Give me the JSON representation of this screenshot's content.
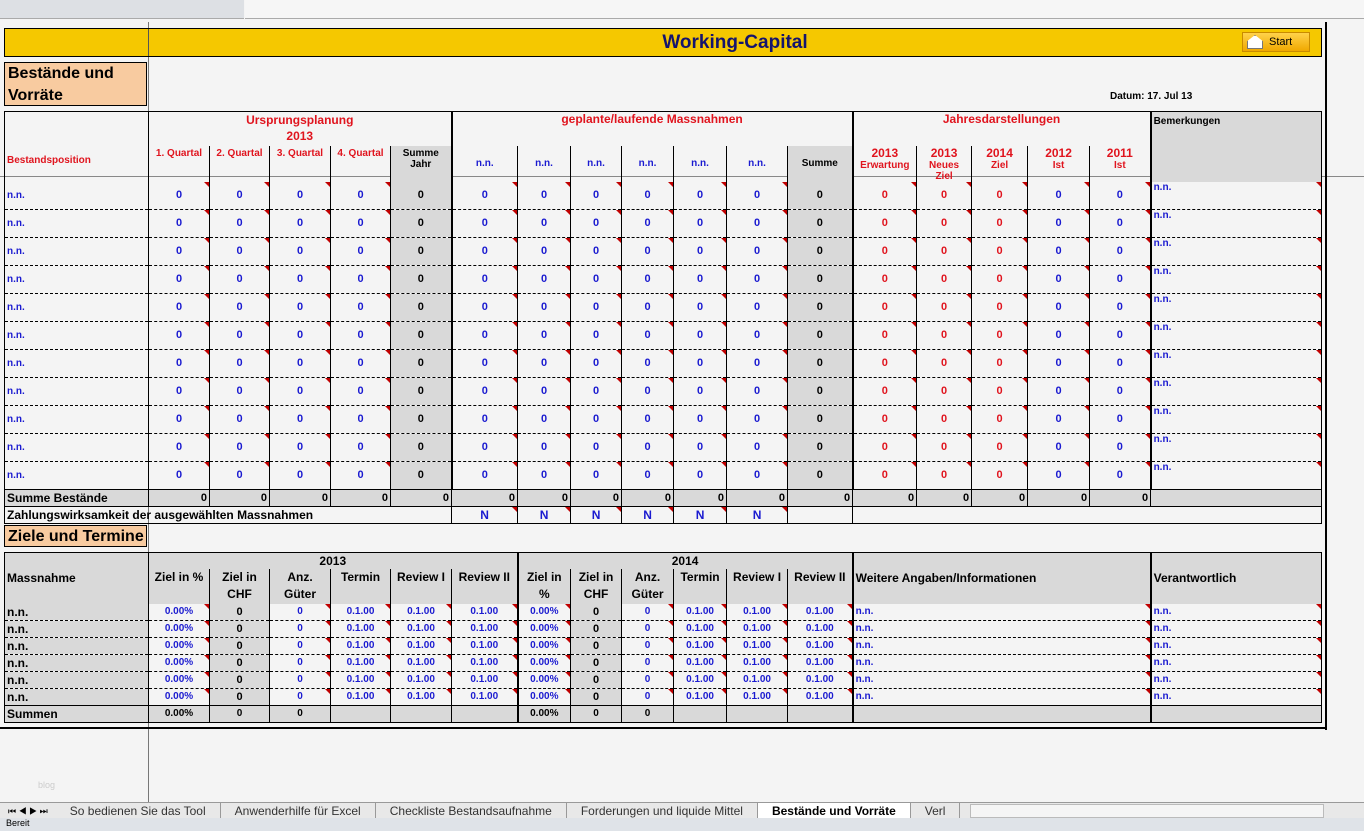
{
  "title": "Working-Capital",
  "start_label": "Start",
  "section1": "Bestände und Vorräte",
  "datum_label": "Datum:",
  "datum_value": "17. Jul 13",
  "top": {
    "pos_header": "Bestandsposition",
    "group1": "Ursprungsplanung",
    "group1_year": "2013",
    "quarters": [
      "1. Quartal",
      "2. Quartal",
      "3. Quartal",
      "4. Quartal"
    ],
    "sum_year": "Summe Jahr",
    "group2": "geplante/laufende Massnahmen",
    "measures": [
      "n.n.",
      "n.n.",
      "n.n.",
      "n.n.",
      "n.n.",
      "n.n."
    ],
    "sum": "Summe",
    "group3": "Jahresdarstellungen",
    "years": [
      {
        "y": "2013",
        "l": "Erwartung"
      },
      {
        "y": "2013",
        "l": "Neues Ziel"
      },
      {
        "y": "2014",
        "l": "Ziel"
      },
      {
        "y": "2012",
        "l": "Ist"
      },
      {
        "y": "2011",
        "l": "Ist"
      }
    ],
    "remarks": "Bemerkungen",
    "rows": [
      [
        "n.n.",
        "0",
        "0",
        "0",
        "0",
        "0",
        "0",
        "0",
        "0",
        "0",
        "0",
        "0",
        "0",
        "0",
        "0",
        "0",
        "0",
        "0",
        "n.n."
      ],
      [
        "n.n.",
        "0",
        "0",
        "0",
        "0",
        "0",
        "0",
        "0",
        "0",
        "0",
        "0",
        "0",
        "0",
        "0",
        "0",
        "0",
        "0",
        "0",
        "n.n."
      ],
      [
        "n.n.",
        "0",
        "0",
        "0",
        "0",
        "0",
        "0",
        "0",
        "0",
        "0",
        "0",
        "0",
        "0",
        "0",
        "0",
        "0",
        "0",
        "0",
        "n.n."
      ],
      [
        "n.n.",
        "0",
        "0",
        "0",
        "0",
        "0",
        "0",
        "0",
        "0",
        "0",
        "0",
        "0",
        "0",
        "0",
        "0",
        "0",
        "0",
        "0",
        "n.n."
      ],
      [
        "n.n.",
        "0",
        "0",
        "0",
        "0",
        "0",
        "0",
        "0",
        "0",
        "0",
        "0",
        "0",
        "0",
        "0",
        "0",
        "0",
        "0",
        "0",
        "n.n."
      ],
      [
        "n.n.",
        "0",
        "0",
        "0",
        "0",
        "0",
        "0",
        "0",
        "0",
        "0",
        "0",
        "0",
        "0",
        "0",
        "0",
        "0",
        "0",
        "0",
        "n.n."
      ],
      [
        "n.n.",
        "0",
        "0",
        "0",
        "0",
        "0",
        "0",
        "0",
        "0",
        "0",
        "0",
        "0",
        "0",
        "0",
        "0",
        "0",
        "0",
        "0",
        "n.n."
      ],
      [
        "n.n.",
        "0",
        "0",
        "0",
        "0",
        "0",
        "0",
        "0",
        "0",
        "0",
        "0",
        "0",
        "0",
        "0",
        "0",
        "0",
        "0",
        "0",
        "n.n."
      ],
      [
        "n.n.",
        "0",
        "0",
        "0",
        "0",
        "0",
        "0",
        "0",
        "0",
        "0",
        "0",
        "0",
        "0",
        "0",
        "0",
        "0",
        "0",
        "0",
        "n.n."
      ],
      [
        "n.n.",
        "0",
        "0",
        "0",
        "0",
        "0",
        "0",
        "0",
        "0",
        "0",
        "0",
        "0",
        "0",
        "0",
        "0",
        "0",
        "0",
        "0",
        "n.n."
      ],
      [
        "n.n.",
        "0",
        "0",
        "0",
        "0",
        "0",
        "0",
        "0",
        "0",
        "0",
        "0",
        "0",
        "0",
        "0",
        "0",
        "0",
        "0",
        "0",
        "n.n."
      ]
    ],
    "sum_row": [
      "Summe Bestände",
      "0",
      "0",
      "0",
      "0",
      "0",
      "0",
      "0",
      "0",
      "0",
      "0",
      "0",
      "0",
      "0",
      "0",
      "0",
      "0",
      "0",
      ""
    ],
    "pay_label": "Zahlungswirksamkeit der ausgewählten Massnahmen",
    "pay_values": [
      "N",
      "N",
      "N",
      "N",
      "N",
      "N"
    ]
  },
  "section2": "Ziele und Termine",
  "bottom": {
    "massnahme": "Massnahme",
    "year1": "2013",
    "year2": "2014",
    "cols": [
      "Ziel in %",
      "Ziel in CHF",
      "Anz. Güter",
      "Termin",
      "Review I",
      "Review II",
      "Ziel in %",
      "Ziel in CHF",
      "Anz. Güter",
      "Termin",
      "Review I",
      "Review II"
    ],
    "info": "Weitere Angaben/Informationen",
    "resp": "Verantwortlich",
    "rows": [
      [
        "n.n.",
        "0.00%",
        "0",
        "0",
        "0.1.00",
        "0.1.00",
        "0.1.00",
        "0.00%",
        "0",
        "0",
        "0.1.00",
        "0.1.00",
        "0.1.00",
        "n.n.",
        "n.n."
      ],
      [
        "n.n.",
        "0.00%",
        "0",
        "0",
        "0.1.00",
        "0.1.00",
        "0.1.00",
        "0.00%",
        "0",
        "0",
        "0.1.00",
        "0.1.00",
        "0.1.00",
        "n.n.",
        "n.n."
      ],
      [
        "n.n.",
        "0.00%",
        "0",
        "0",
        "0.1.00",
        "0.1.00",
        "0.1.00",
        "0.00%",
        "0",
        "0",
        "0.1.00",
        "0.1.00",
        "0.1.00",
        "n.n.",
        "n.n."
      ],
      [
        "n.n.",
        "0.00%",
        "0",
        "0",
        "0.1.00",
        "0.1.00",
        "0.1.00",
        "0.00%",
        "0",
        "0",
        "0.1.00",
        "0.1.00",
        "0.1.00",
        "n.n.",
        "n.n."
      ],
      [
        "n.n.",
        "0.00%",
        "0",
        "0",
        "0.1.00",
        "0.1.00",
        "0.1.00",
        "0.00%",
        "0",
        "0",
        "0.1.00",
        "0.1.00",
        "0.1.00",
        "n.n.",
        "n.n."
      ],
      [
        "n.n.",
        "0.00%",
        "0",
        "0",
        "0.1.00",
        "0.1.00",
        "0.1.00",
        "0.00%",
        "0",
        "0",
        "0.1.00",
        "0.1.00",
        "0.1.00",
        "n.n.",
        "n.n."
      ]
    ],
    "sum_row": [
      "Summen",
      "0.00%",
      "0",
      "0",
      "",
      "",
      "",
      "0.00%",
      "0",
      "0",
      "",
      "",
      "",
      "",
      ""
    ]
  },
  "sheet_tabs": [
    "So bedienen Sie das Tool",
    "Anwenderhilfe für Excel",
    "Checkliste Bestandsaufnahme",
    "Forderungen und liquide Mittel",
    "Bestände und Vorräte",
    "Verl"
  ],
  "active_tab": 4,
  "status": "Bereit"
}
